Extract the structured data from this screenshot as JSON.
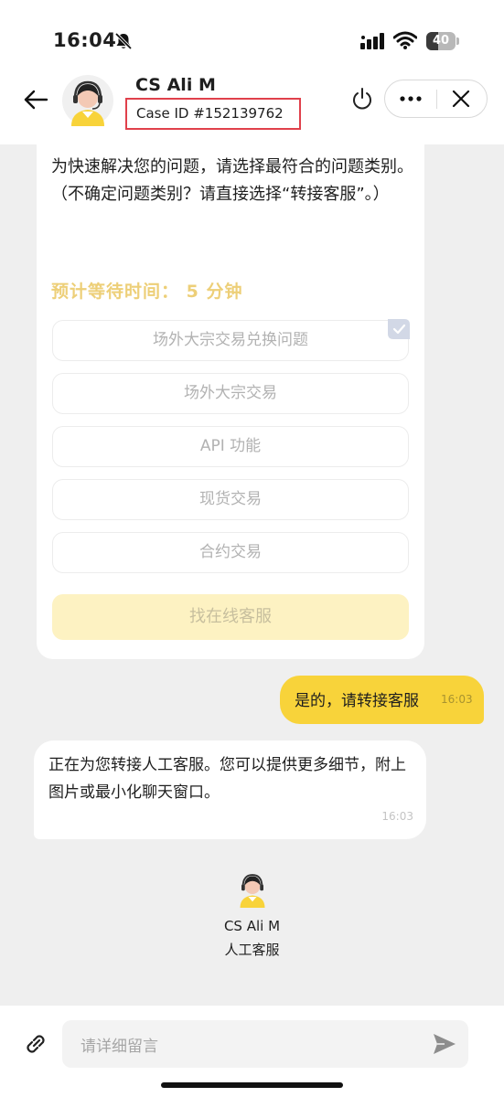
{
  "status_bar": {
    "time": "16:04",
    "battery_level": "40",
    "battery_percent": 40
  },
  "header": {
    "agent_name": "CS Ali M",
    "case_id": "Case ID #152139762"
  },
  "bot_card": {
    "text": "为快速解决您的问题，请选择最符合的问题类别。\n（不确定问题类别？请直接选择“转接客服”。）",
    "wait_label": "预计等待时间： 5 分钟",
    "options": [
      "场外大宗交易兑换问题",
      "场外大宗交易",
      "API 功能",
      "现货交易",
      "合约交易"
    ],
    "online_cs_label": "找在线客服"
  },
  "user_message": {
    "text": "是的，请转接客服",
    "time": "16:03"
  },
  "bot_message": {
    "text": "正在为您转接人工客服。您可以提供更多细节，附上图片或最小化聊天窗口。",
    "time": "16:03"
  },
  "agent_card": {
    "name": "CS Ali M",
    "role": "人工客服"
  },
  "input": {
    "placeholder": "请详细留言"
  },
  "colors": {
    "accent_yellow": "#f8d33a",
    "highlight_red": "#e0404b",
    "wait_text": "#edcf78"
  },
  "icons": [
    "bell-slash-icon",
    "signal-icon",
    "wifi-icon",
    "back-arrow-icon",
    "power-icon",
    "more-icon",
    "close-icon",
    "check-icon",
    "link-icon",
    "send-icon"
  ]
}
